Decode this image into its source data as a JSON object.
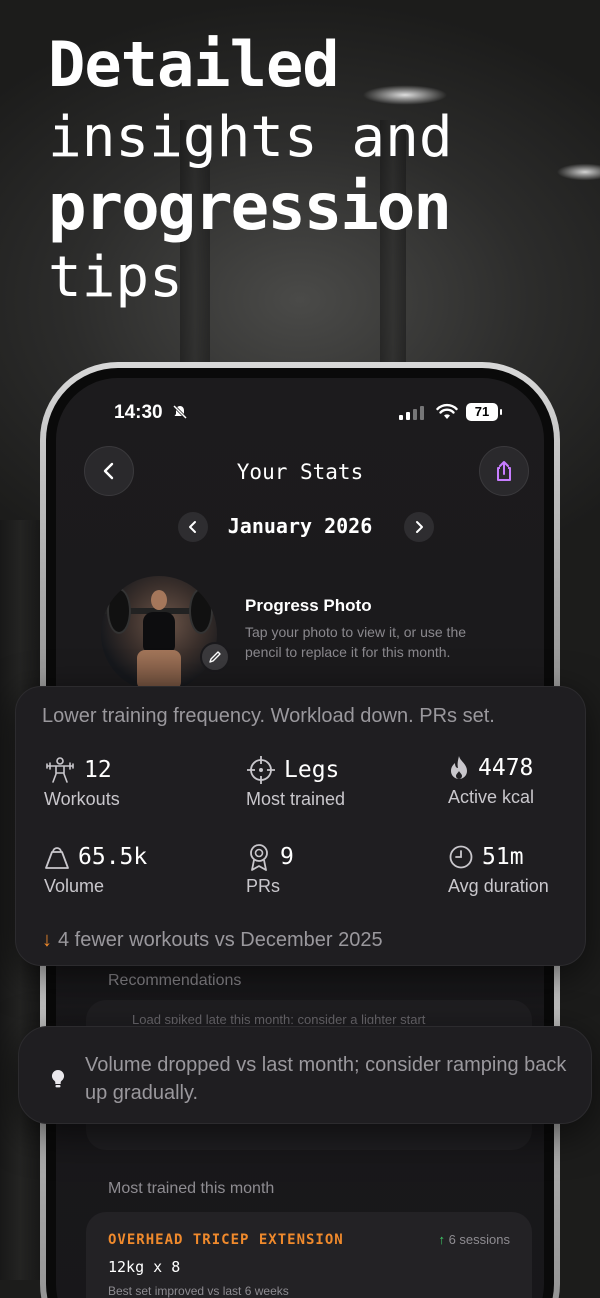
{
  "headline": {
    "line1": "Detailed",
    "line2": "insights and",
    "line3": "progression",
    "line4": "tips"
  },
  "status_bar": {
    "time": "14:30",
    "battery": "71"
  },
  "header": {
    "title": "Your Stats",
    "month": "January 2026"
  },
  "progress_photo": {
    "title": "Progress Photo",
    "description": "Tap your photo to view it, or use the pencil to replace it for this month."
  },
  "stats": {
    "summary": "Lower training frequency. Workload down. PRs set.",
    "items": [
      {
        "value": "12",
        "label": "Workouts",
        "icon": "person-weights-icon"
      },
      {
        "value": "Legs",
        "label": "Most trained",
        "icon": "crosshair-icon"
      },
      {
        "value": "4478",
        "label": "Active kcal",
        "icon": "flame-icon"
      },
      {
        "value": "65.5k",
        "label": "Volume",
        "icon": "kettlebell-icon"
      },
      {
        "value": "9",
        "label": "PRs",
        "icon": "medal-icon"
      },
      {
        "value": "51m",
        "label": "Avg duration",
        "icon": "clock-icon"
      }
    ],
    "delta": "4 fewer workouts vs December 2025"
  },
  "recommendations": {
    "label": "Recommendations",
    "faded_text": "Load spiked late this month; consider a lighter start",
    "tip": "Volume dropped vs last month; consider ramping back up gradually."
  },
  "most_trained": {
    "label": "Most trained this month",
    "exercise": {
      "name": "OVERHEAD TRICEP EXTENSION",
      "sessions": "6 sessions",
      "set": "12kg x 8",
      "note": "Best set improved vs last 6 weeks"
    }
  },
  "colors": {
    "accent_orange": "#f08a2c",
    "up_green": "#3ecf6a",
    "share_purple": "#c77dff"
  }
}
